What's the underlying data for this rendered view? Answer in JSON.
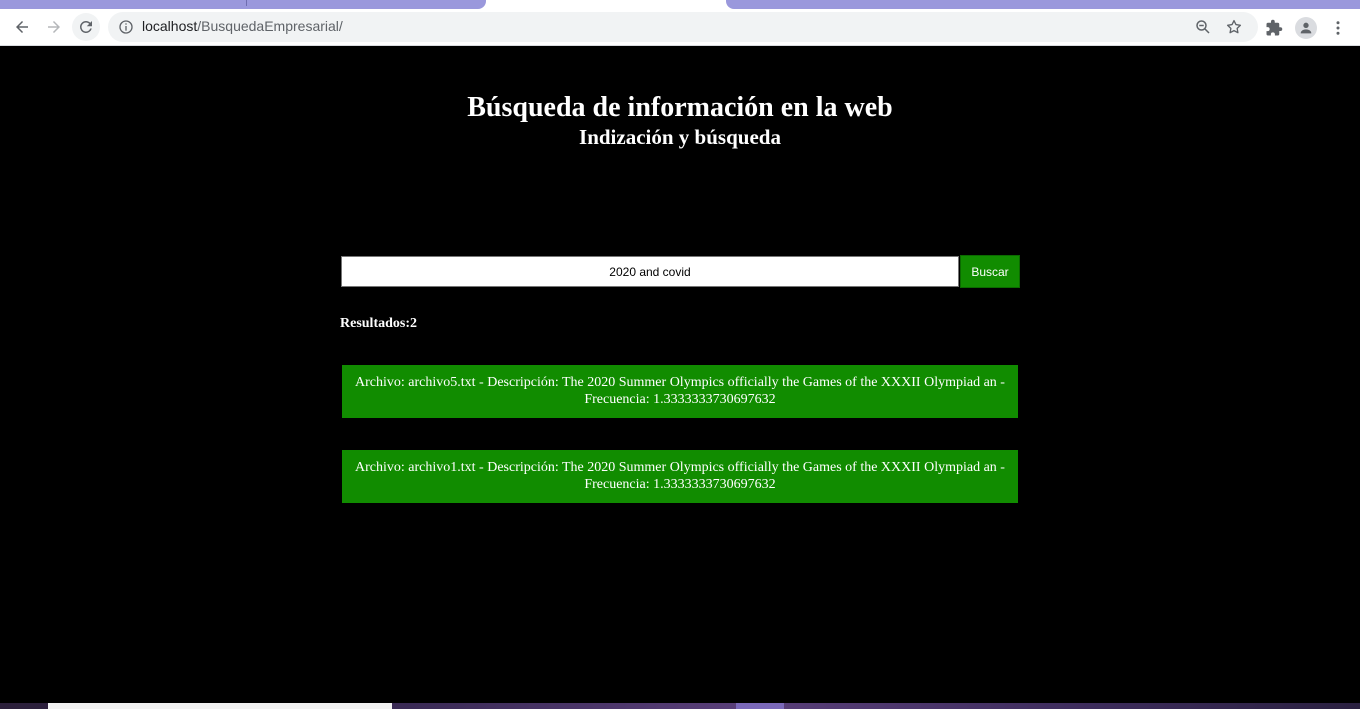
{
  "browser": {
    "url_host": "localhost",
    "url_path": "/BusquedaEmpresarial/"
  },
  "page": {
    "title": "Búsqueda de información en la web",
    "subtitle": "Indización y búsqueda",
    "search": {
      "value": "2020 and covid",
      "button_label": "Buscar"
    },
    "results_label": "Resultados:2",
    "results": [
      {
        "text": "Archivo: archivo5.txt - Descripción: The 2020 Summer Olympics officially the Games of the XXXII Olympiad an - Frecuencia: 1.3333333730697632"
      },
      {
        "text": "Archivo: archivo1.txt - Descripción: The 2020 Summer Olympics officially the Games of the XXXII Olympiad an - Frecuencia: 1.3333333730697632"
      }
    ]
  },
  "colors": {
    "accent_green": "#118c00",
    "background": "#000000",
    "tab_purple": "#9a98dc"
  }
}
